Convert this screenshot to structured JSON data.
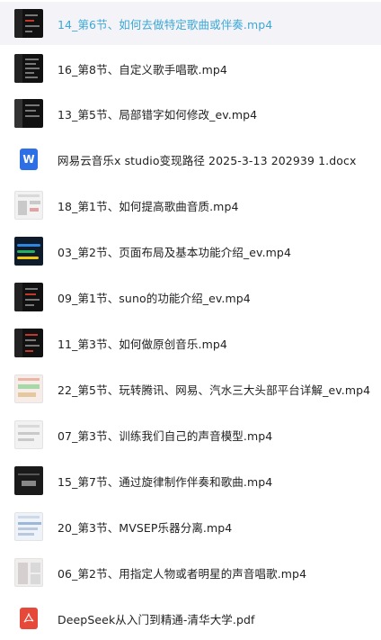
{
  "files": [
    {
      "name": "14_第6节、如何去做特定歌曲或伴奏.mp4",
      "icon": "video-thumbnail",
      "selected": true
    },
    {
      "name": "16_第8节、自定义歌手唱歌.mp4",
      "icon": "video-thumbnail"
    },
    {
      "name": "13_第5节、局部错字如何修改_ev.mp4",
      "icon": "video-thumbnail"
    },
    {
      "name": "网易云音乐x studio变现路径 2025-3-13 202939 1.docx",
      "icon": "word-doc-icon",
      "icon_glyph": "W"
    },
    {
      "name": "18_第1节、如何提高歌曲音质.mp4",
      "icon": "video-thumbnail"
    },
    {
      "name": "03_第2节、页面布局及基本功能介绍_ev.mp4",
      "icon": "video-thumbnail"
    },
    {
      "name": "09_第1节、suno的功能介绍_ev.mp4",
      "icon": "video-thumbnail"
    },
    {
      "name": "11_第3节、如何做原创音乐.mp4",
      "icon": "video-thumbnail"
    },
    {
      "name": "22_第5节、玩转腾讯、网易、汽水三大头部平台详解_ev.mp4",
      "icon": "video-thumbnail"
    },
    {
      "name": "07_第3节、训练我们自己的声音模型.mp4",
      "icon": "video-thumbnail"
    },
    {
      "name": "15_第7节、通过旋律制作伴奏和歌曲.mp4",
      "icon": "video-thumbnail"
    },
    {
      "name": "20_第3节、MVSEP乐器分离.mp4",
      "icon": "video-thumbnail"
    },
    {
      "name": "06_第2节、用指定人物或者明星的声音唱歌.mp4",
      "icon": "video-thumbnail"
    },
    {
      "name": "DeepSeek从入门到精通-清华大学.pdf",
      "icon": "pdf-doc-icon"
    }
  ],
  "colors": {
    "selected_text": "#3da8d6",
    "selected_bg": "#f3f3f8",
    "word": "#2f6fe6",
    "pdf": "#e6493a"
  }
}
